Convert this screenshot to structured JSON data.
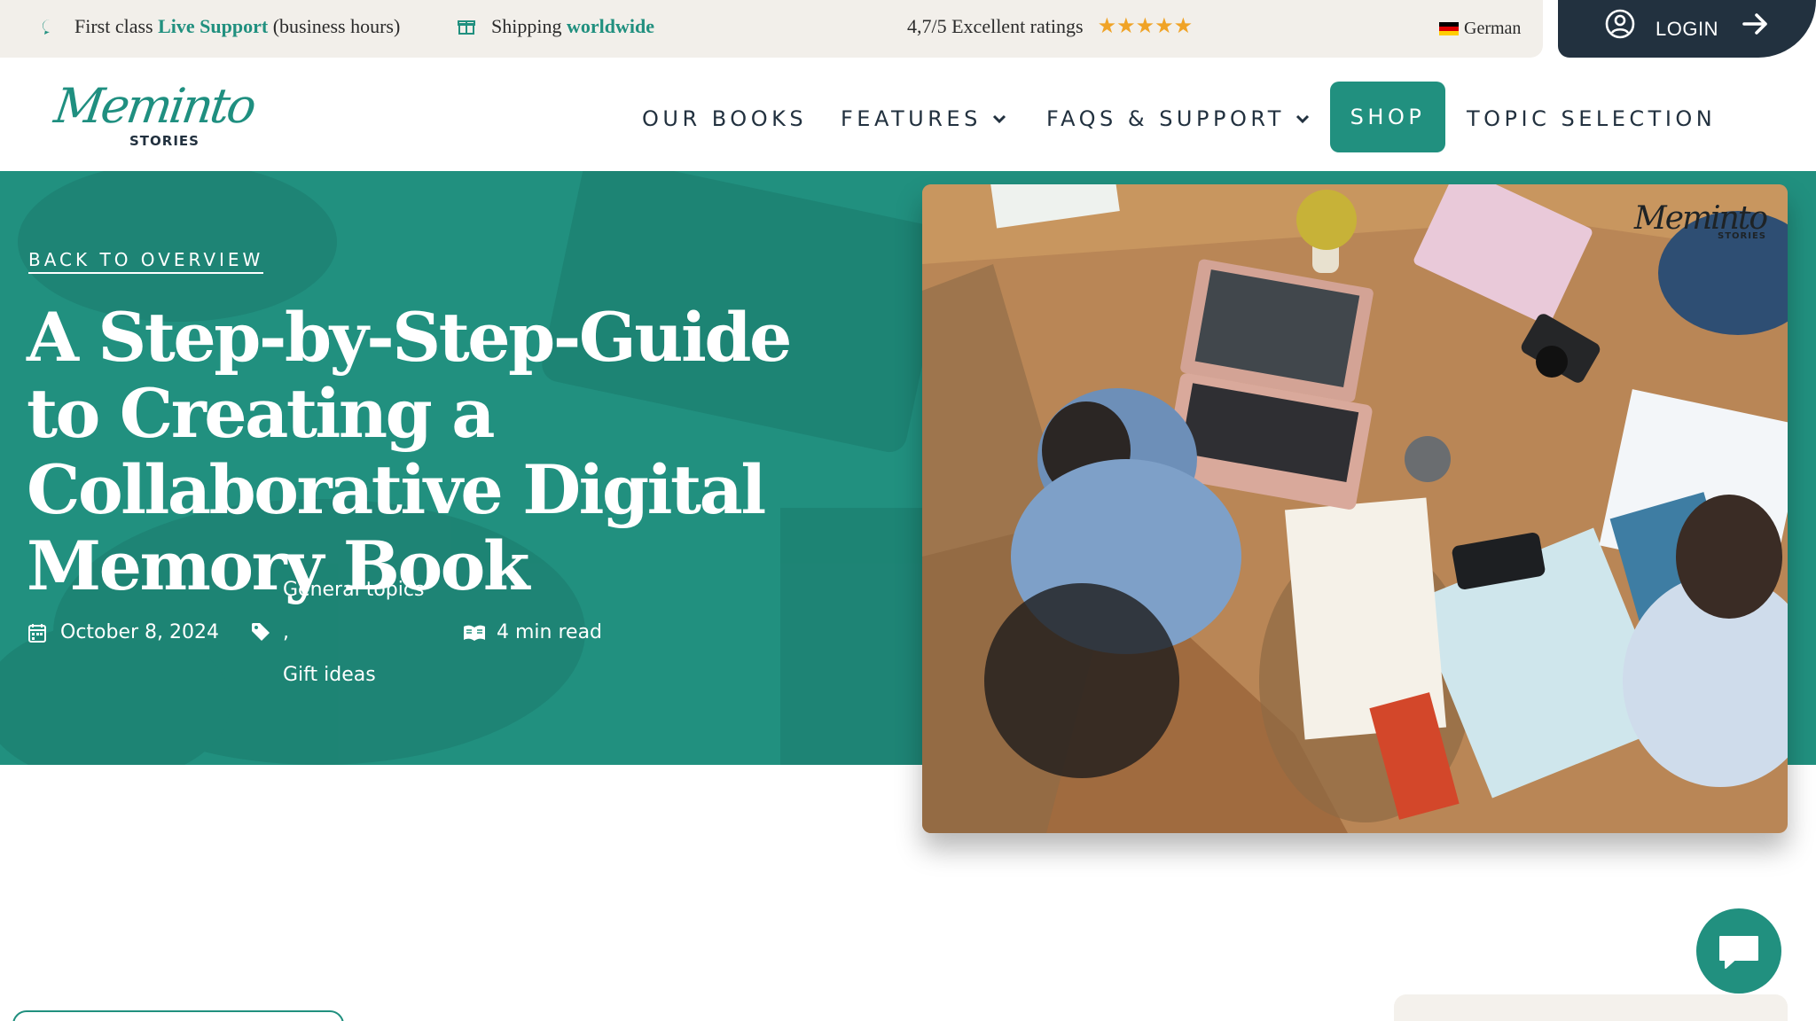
{
  "topbar": {
    "support_prefix": "First class",
    "support_accent": "Live Support",
    "support_suffix": "(business hours)",
    "shipping_prefix": "Shipping",
    "shipping_accent": "worldwide",
    "ratings_text": "4,7/5 Excellent ratings",
    "rating_stars": 5,
    "language_label": "German",
    "login_label": "LOGIN"
  },
  "logo": {
    "script": "Meminto",
    "sub": "STORIES"
  },
  "nav": {
    "items": [
      {
        "label": "OUR BOOKS"
      },
      {
        "label": "FEATURES"
      },
      {
        "label": "FAQS & SUPPORT"
      },
      {
        "label": "SHOP"
      },
      {
        "label": "TOPIC SELECTION"
      }
    ]
  },
  "hero": {
    "back_link": "BACK TO OVERVIEW",
    "title": "A Step-by-Step-Guide to Creating a Collaborative Digital Memory Book",
    "date": "October 8, 2024",
    "tag_1": "General topics",
    "tag_separator": ",",
    "tag_2": "Gift ideas",
    "read_time": "4 min read",
    "photo_logo_script": "Meminto",
    "photo_logo_sub": "STORIES"
  },
  "colors": {
    "brand_teal": "#21907f",
    "dark_navy": "#22313f",
    "topbar_bg": "#f2efea",
    "star_gold": "#f0a326"
  },
  "icons": [
    "chat-bubble-icon",
    "gift-icon",
    "star-icon",
    "flag-germany-icon",
    "user-circle-icon",
    "arrow-right-icon",
    "chevron-down-icon",
    "calendar-icon",
    "tag-icon",
    "book-open-icon",
    "chat-icon"
  ]
}
